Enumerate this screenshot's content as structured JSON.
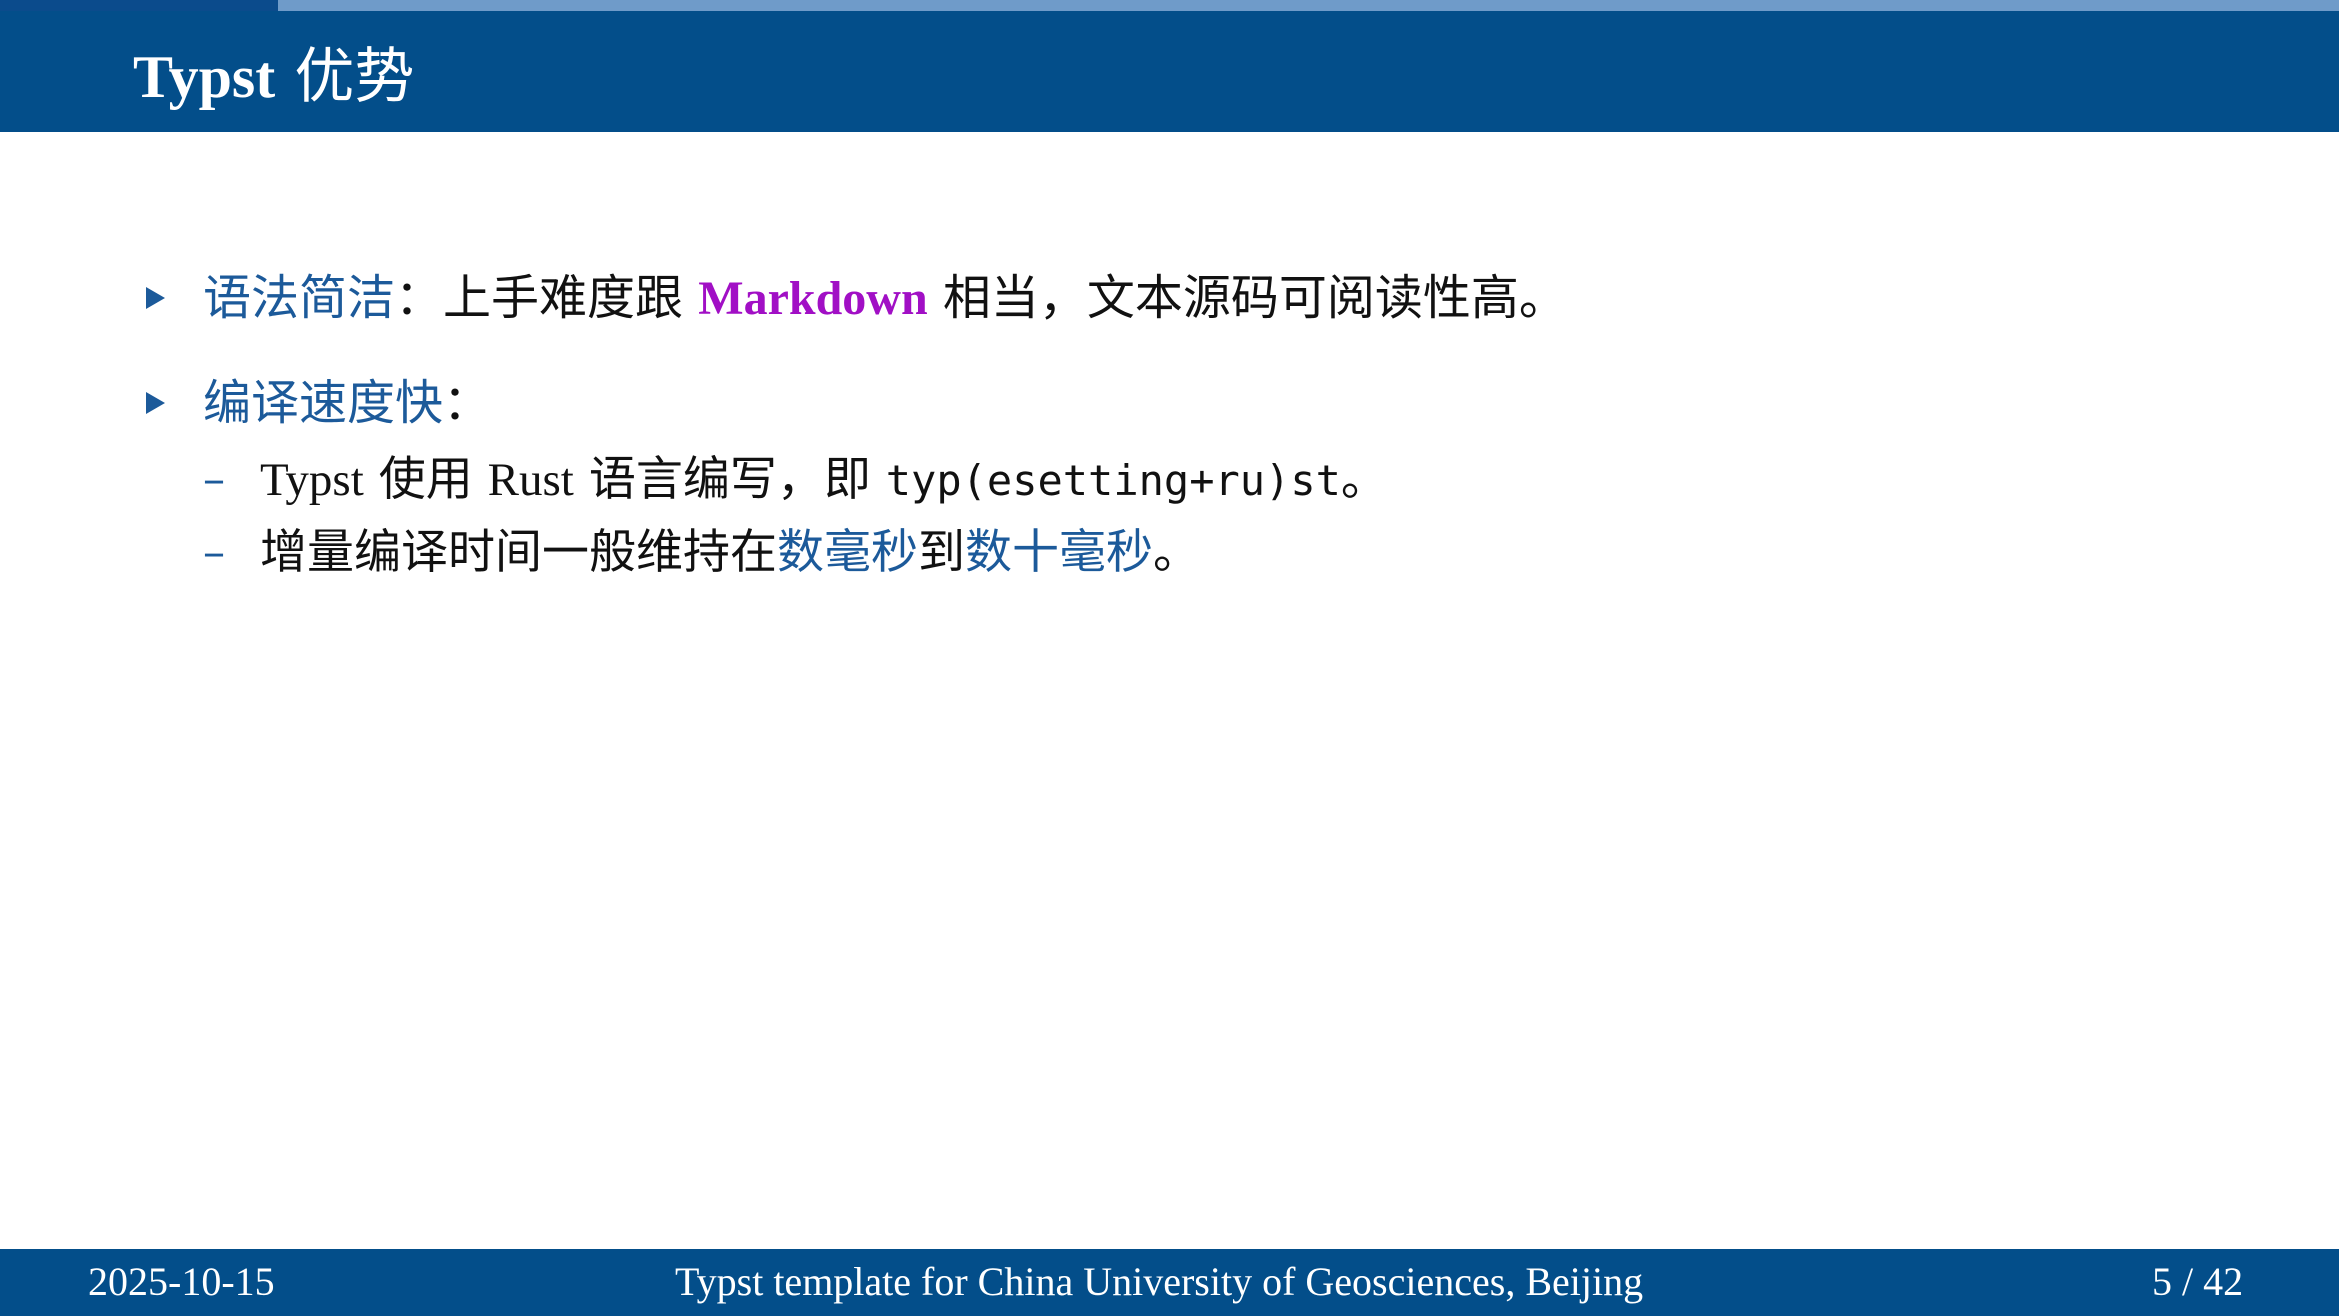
{
  "progress": {
    "current": 5,
    "total": 42
  },
  "slide": {
    "title_latin": "Typst",
    "title_cjk": "优势"
  },
  "bullets": [
    {
      "label": "语法简洁",
      "sep": "：",
      "text_pre": "上手难度跟 ",
      "highlight": "Markdown",
      "text_post": " 相当，文本源码可阅读性高。"
    },
    {
      "label": "编译速度快",
      "sep": "：",
      "subitems": [
        {
          "dash": "–",
          "latin1": "Typst",
          "cjk1": " 使用 ",
          "latin2": "Rust",
          "cjk2": " 语言编写，即 ",
          "code": "typ(esetting+ru)st",
          "end": "。"
        },
        {
          "dash": "–",
          "pre": "增量编译时间一般维持在",
          "hl1": "数毫秒",
          "mid": "到",
          "hl2": "数十毫秒",
          "end": "。"
        }
      ]
    }
  ],
  "footer": {
    "date": "2025-10-15",
    "title": "Typst template for China University of Geosciences, Beijing",
    "page": "5 / 42"
  },
  "colors": {
    "header_bg": "#034e8a",
    "accent_blue": "#1c5a9a",
    "highlight_purple": "#a10fc5",
    "progress_track": "#6f9bc9",
    "progress_fill": "#0b4b8c"
  }
}
